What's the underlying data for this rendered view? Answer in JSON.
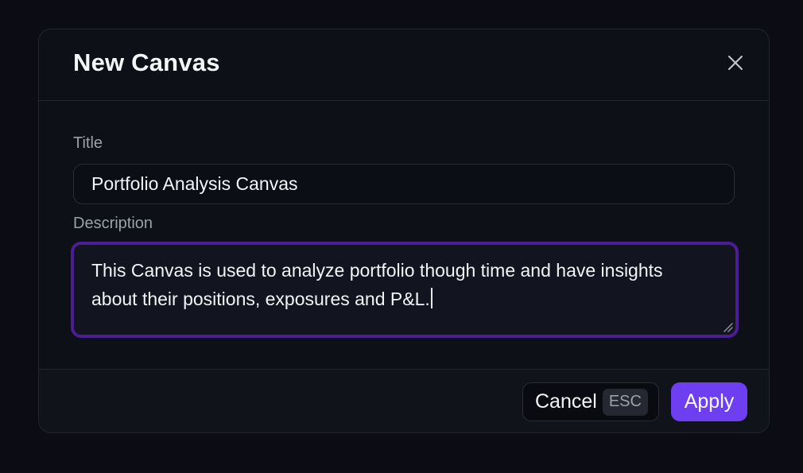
{
  "modal": {
    "title": "New Canvas"
  },
  "form": {
    "title_label": "Title",
    "title_value": "Portfolio Analysis Canvas",
    "description_label": "Description",
    "description_value": "This Canvas is used to analyze portfolio though time and have insights about their positions, exposures and P&L."
  },
  "footer": {
    "cancel_label": "Cancel",
    "cancel_shortcut": "ESC",
    "apply_label": "Apply"
  },
  "colors": {
    "background": "#0b0c14",
    "panel": "#0e1018",
    "accent": "#6d3ff0",
    "focus_ring": "#4c1d95"
  },
  "icons": {
    "close": "close-icon",
    "resize": "resize-handle-icon"
  }
}
